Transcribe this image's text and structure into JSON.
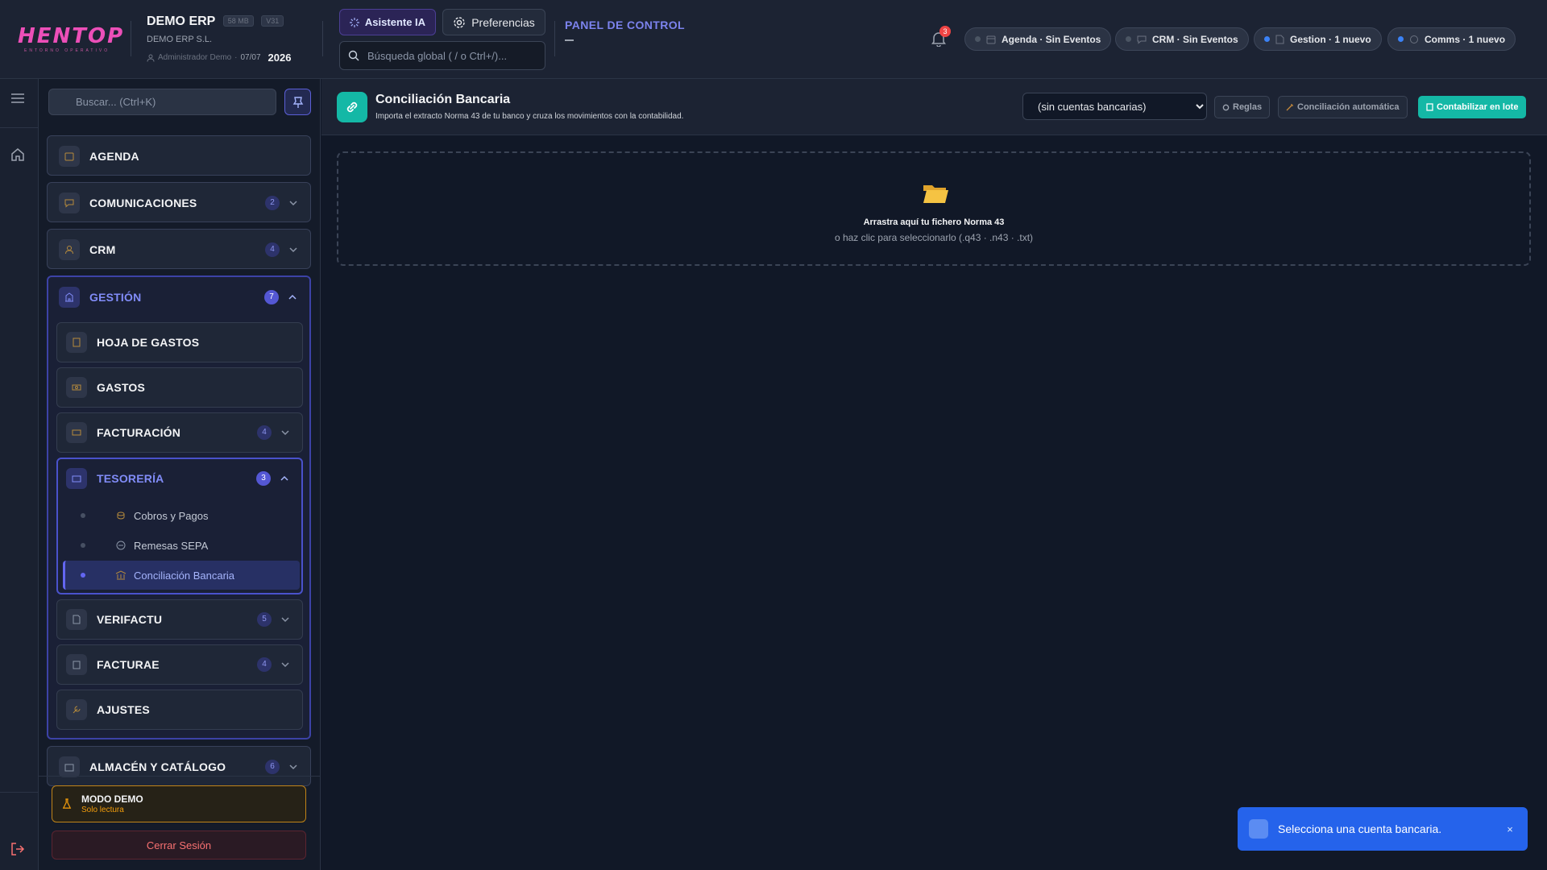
{
  "header": {
    "logo_text": "HENTOP",
    "logo_subtext": "ENTORNO OPERATIVO",
    "company_name": "DEMO ERP",
    "size_tag": "58 MB",
    "version_tag": "V31",
    "legal_name": "DEMO ERP S.L.",
    "user": "Administrador Demo",
    "separator": "·",
    "date": "07/07",
    "year": "2026",
    "ai_button": "Asistente IA",
    "prefs_button": "Preferencias",
    "global_search_placeholder": "Búsqueda global ( / o Ctrl+/)...",
    "panel_title": "PANEL DE CONTROL",
    "notification_count": "3",
    "chips": [
      {
        "label": "Agenda · Sin Eventos",
        "status": "inactive"
      },
      {
        "label": "CRM · Sin Eventos",
        "status": "inactive"
      },
      {
        "label": "Gestion · 1 nuevo",
        "status": "active"
      },
      {
        "label": "Comms · 1 nuevo",
        "status": "active"
      }
    ]
  },
  "sidebar": {
    "search_placeholder": "Buscar... (Ctrl+K)",
    "groups": [
      {
        "label": "AGENDA",
        "badge": ""
      },
      {
        "label": "COMUNICACIONES",
        "badge": "2"
      },
      {
        "label": "CRM",
        "badge": "4"
      },
      {
        "label": "GESTIÓN",
        "badge": "7",
        "expanded": true
      },
      {
        "label": "ALMACÉN Y CATÁLOGO",
        "badge": "6"
      }
    ],
    "gestion_items": [
      {
        "label": "HOJA DE GASTOS",
        "badge": ""
      },
      {
        "label": "GASTOS",
        "badge": ""
      },
      {
        "label": "FACTURACIÓN",
        "badge": "4"
      },
      {
        "label": "TESORERÍA",
        "badge": "3",
        "expanded": true
      },
      {
        "label": "VERIFACTU",
        "badge": "5"
      },
      {
        "label": "FACTURAE",
        "badge": "4"
      },
      {
        "label": "AJUSTES",
        "badge": ""
      }
    ],
    "tesoreria_items": [
      {
        "label": "Cobros y Pagos"
      },
      {
        "label": "Remesas SEPA"
      },
      {
        "label": "Conciliación Bancaria",
        "active": true
      }
    ],
    "demo_title": "MODO DEMO",
    "demo_subtitle": "Solo lectura",
    "logout": "Cerrar Sesión"
  },
  "main": {
    "title": "Conciliación Bancaria",
    "subtitle": "Importa el extracto Norma 43 de tu banco y cruza los movimientos con la contabilidad.",
    "account_select": "(sin cuentas bancarias)",
    "rules_button": "Reglas",
    "auto_button": "Conciliación automática",
    "batch_button": "Contabilizar en lote",
    "dropzone_title": "Arrastra aquí tu fichero Norma 43",
    "dropzone_subtitle": "o haz clic para seleccionarlo (.q43 · .n43 · .txt)"
  },
  "toast": {
    "message": "Selecciona una cuenta bancaria.",
    "close": "×"
  },
  "colors": {
    "accent": "#6366f1",
    "teal": "#14b8a6",
    "brand_pink": "#ec4fb8",
    "toast_blue": "#2563eb",
    "demo_amber": "#f59e0b",
    "logout_red": "#f87171"
  },
  "icons": [
    "hamburger-icon",
    "home-icon",
    "flask-icon",
    "logout-icon",
    "search-icon",
    "sparkle-icon",
    "gear-icon",
    "bell-icon",
    "calendar-icon",
    "chat-icon",
    "document-icon",
    "pin-icon",
    "chevron-down-icon",
    "chevron-up-icon",
    "link-icon",
    "folder-icon",
    "info-icon"
  ]
}
